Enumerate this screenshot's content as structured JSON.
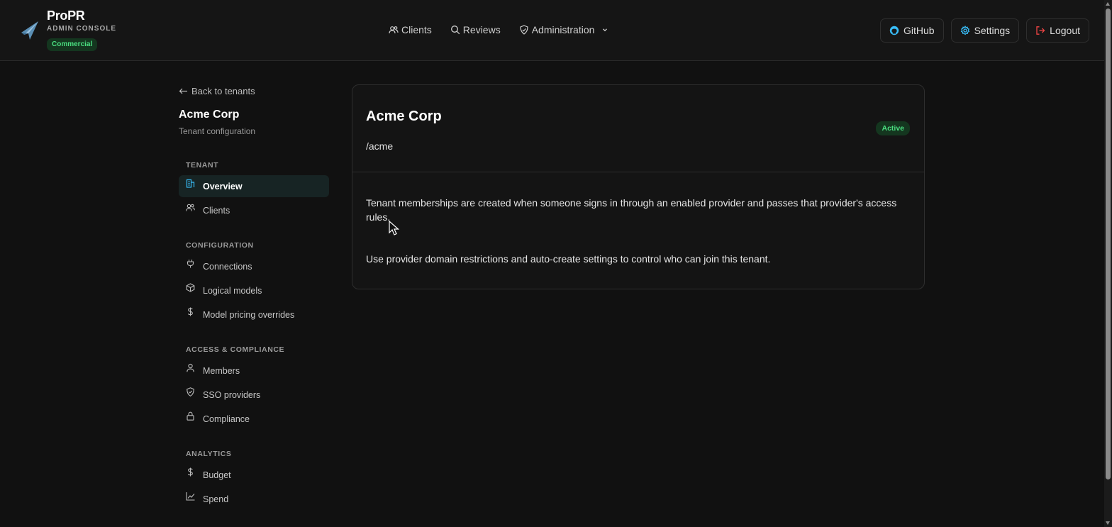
{
  "brand": {
    "name": "ProPR",
    "subtitle": "ADMIN CONSOLE",
    "badge": "Commercial",
    "logo_icon": "paper-plane-icon"
  },
  "nav": {
    "clients": "Clients",
    "reviews": "Reviews",
    "administration": "Administration"
  },
  "actions": {
    "github": "GitHub",
    "settings": "Settings",
    "logout": "Logout"
  },
  "sidebar": {
    "back": "Back to tenants",
    "title": "Acme Corp",
    "subtitle": "Tenant configuration",
    "sections": [
      {
        "label": "TENANT",
        "items": [
          {
            "label": "Overview",
            "icon": "building-icon",
            "active": true
          },
          {
            "label": "Clients",
            "icon": "users-icon"
          }
        ]
      },
      {
        "label": "CONFIGURATION",
        "items": [
          {
            "label": "Connections",
            "icon": "plug-icon"
          },
          {
            "label": "Logical models",
            "icon": "cube-icon"
          },
          {
            "label": "Model pricing overrides",
            "icon": "dollar-icon"
          }
        ]
      },
      {
        "label": "ACCESS & COMPLIANCE",
        "items": [
          {
            "label": "Members",
            "icon": "user-icon"
          },
          {
            "label": "SSO providers",
            "icon": "shield-icon"
          },
          {
            "label": "Compliance",
            "icon": "lock-icon"
          }
        ]
      },
      {
        "label": "ANALYTICS",
        "items": [
          {
            "label": "Budget",
            "icon": "dollar-icon"
          },
          {
            "label": "Spend",
            "icon": "chart-line-icon"
          }
        ]
      }
    ]
  },
  "card": {
    "title": "Acme Corp",
    "path": "/acme",
    "status": "Active",
    "paragraphs": [
      "Tenant memberships are created when someone signs in through an enabled provider and passes that provider's access rules.",
      "Use provider domain restrictions and auto-create settings to control who can join this tenant."
    ]
  },
  "colors": {
    "background": "#111111",
    "accent_green": "#4ade80",
    "accent_blue": "#38bdf8",
    "logout_red": "#ef4444",
    "active_item_bg": "#172424"
  }
}
